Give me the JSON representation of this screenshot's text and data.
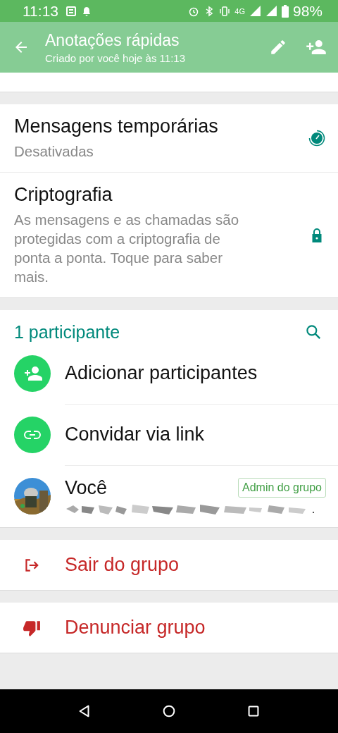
{
  "status_bar": {
    "time": "11:13",
    "network": "4G",
    "battery": "98%"
  },
  "header": {
    "title": "Anotações rápidas",
    "subtitle": "Criado por você hoje às 11:13"
  },
  "settings": [
    {
      "kind": "timer",
      "title": "Mensagens temporárias",
      "subtitle": "Desativadas"
    },
    {
      "kind": "lock",
      "title": "Criptografia",
      "subtitle": "As mensagens e as chamadas são protegidas com a criptografia de ponta a ponta. Toque para saber mais."
    }
  ],
  "participants": {
    "heading": "1 participante",
    "actions": [
      {
        "kind": "add",
        "label": "Adicionar participantes"
      },
      {
        "kind": "link",
        "label": "Convidar via link"
      }
    ],
    "members": [
      {
        "name": "Você",
        "badge": "Admin do grupo"
      }
    ]
  },
  "exit_actions": [
    {
      "kind": "exit",
      "label": "Sair do grupo"
    },
    {
      "kind": "report",
      "label": "Denunciar grupo"
    }
  ]
}
